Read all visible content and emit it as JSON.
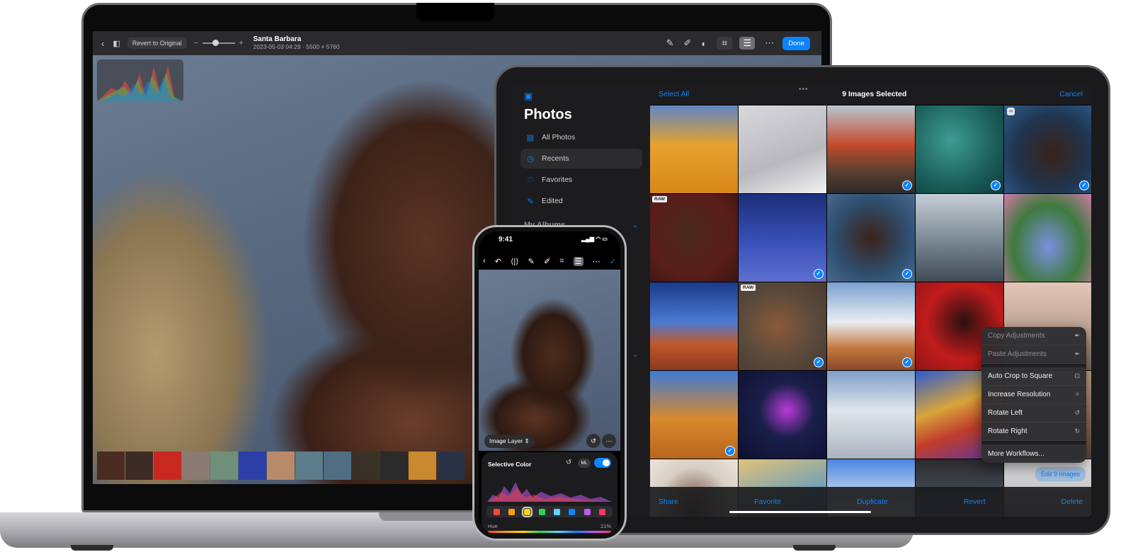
{
  "mac": {
    "toolbar": {
      "back_icon": "chevron-left-icon",
      "compare_icon": "compare-icon",
      "revert_label": "Revert to Original",
      "zoom_minus": "−",
      "zoom_plus": "+",
      "photo_title": "Santa Barbara",
      "photo_meta": "2023-05-03 04:29 · 5500 × 5760",
      "done_label": "Done",
      "tools": [
        "markup-icon",
        "retouch-icon",
        "filters-icon",
        "crop-icon",
        "adjust-icon",
        "more-icon"
      ]
    },
    "filmstrip_colors": [
      "#4a2c22",
      "#3d2b26",
      "#c8281f",
      "#8a7a72",
      "#6f8f7a",
      "#2c3fa8",
      "#b88a6a",
      "#5c7c8a",
      "#4f6e84",
      "#3a3228",
      "#2a2a2a",
      "#c9892f",
      "#2a3346"
    ]
  },
  "ipad": {
    "sidebar": {
      "toggle_icon": "sidebar-icon",
      "title": "Photos",
      "items": [
        {
          "label": "All Photos",
          "icon": "photos-icon"
        },
        {
          "label": "Recents",
          "icon": "clock-icon"
        },
        {
          "label": "Favorites",
          "icon": "heart-icon"
        },
        {
          "label": "Edited",
          "icon": "edit-icon"
        }
      ],
      "section": "My Albums"
    },
    "top": {
      "select_all": "Select All",
      "selected_title": "9 Images Selected",
      "cancel": "Cancel",
      "grabber": "•••"
    },
    "thumbs": [
      {
        "bg": "linear-gradient(180deg,#5f86c4 0%,#e6a12e 45%,#d88718 100%)",
        "check": false,
        "raw": false,
        "link": false
      },
      {
        "bg": "linear-gradient(160deg,#d8d8dc,#b8b8be 60%,#f2f2f2)",
        "check": false,
        "raw": false,
        "link": false
      },
      {
        "bg": "linear-gradient(180deg,#b9c6d0 0%,#c34a2c 45%,#5a4030 75%,#2e2a2a 100%)",
        "check": true,
        "raw": false,
        "link": false
      },
      {
        "bg": "radial-gradient(circle at 40% 40%,#3e9c92,#1b5e5a 60%,#0e3b3a)",
        "check": true,
        "raw": false,
        "link": false
      },
      {
        "bg": "radial-gradient(ellipse at 55% 55%,#3a2218,#1f3550 55%,#2f5e8e)",
        "check": true,
        "raw": false,
        "link": true
      },
      {
        "bg": "radial-gradient(ellipse at 45% 45%,#4a2a1d,#5a1e1a 60%,#3b1411)",
        "check": false,
        "raw": true,
        "link": false
      },
      {
        "bg": "linear-gradient(180deg,#1c2f7a 0%,#3a4fb8 55%,#5d6fd0 100%)",
        "check": true,
        "raw": false,
        "link": false
      },
      {
        "bg": "radial-gradient(ellipse at 50% 50%,#3a2218,#2f4f70 60%,#4a6a8e)",
        "check": true,
        "raw": false,
        "link": false
      },
      {
        "bg": "linear-gradient(180deg,#c6cdd6 0%,#7f8d98 50%,#3e4a54 100%)",
        "check": false,
        "raw": false,
        "link": false
      },
      {
        "bg": "radial-gradient(ellipse at 50% 60%,#7b8fe0,#3e7a3e 55%,#d07aa8)",
        "check": false,
        "raw": false,
        "link": false
      },
      {
        "bg": "linear-gradient(180deg,#1a3a8a 0%,#4a7ad0 45%,#c0582c 70%,#8c3a1e 100%)",
        "check": false,
        "raw": false,
        "link": false
      },
      {
        "bg": "radial-gradient(ellipse at 45% 50%,#8a5a38,#5a4a3c 55%,#4a3a30)",
        "check": true,
        "raw": true,
        "link": false
      },
      {
        "bg": "linear-gradient(180deg,#7aa0d0 0%,#e8edf2 45%,#c4783e 75%,#8a4a2a 100%)",
        "check": true,
        "raw": false,
        "link": false
      },
      {
        "bg": "radial-gradient(ellipse at 55% 45%,#2a1010,#c21c1c 55%,#8e1414)",
        "check": false,
        "raw": false,
        "link": false
      },
      {
        "bg": "linear-gradient(180deg,#e3c6b8 0%,#b9a090 60%,#7a6a5e 100%)",
        "check": false,
        "raw": false,
        "link": false
      },
      {
        "bg": "linear-gradient(180deg,#3d7ad6 0%,#d9892c 55%,#b8661e 100%)",
        "check": true,
        "raw": false,
        "link": false
      },
      {
        "bg": "radial-gradient(ellipse at 55% 45%,#b83ad8,#1a1f4a 40%,#0d1030)",
        "check": false,
        "raw": false,
        "link": false
      },
      {
        "bg": "linear-gradient(180deg,#7f9ec8 0%,#dfe5ec 45%,#c9d0d8 70%,#a8b3bf 100%)",
        "check": false,
        "raw": false,
        "link": false
      },
      {
        "bg": "linear-gradient(160deg,#2c5ad0 0%,#d8a43a 40%,#c03c2c 65%,#5a3aa0 100%)",
        "check": false,
        "raw": false,
        "link": false
      },
      {
        "bg": "linear-gradient(180deg,#c9a98c 0%,#8a6a58 60%,#5a4a40 100%)",
        "check": false,
        "raw": false,
        "link": false
      },
      {
        "bg": "radial-gradient(ellipse at 50% 60%,#5a3422,#d8cfc4 60%,#eae4dc)",
        "check": false,
        "raw": false,
        "link": false
      },
      {
        "bg": "linear-gradient(160deg,#e2c27a 0%,#6fa0b8 50%,#3a6e88 100%)",
        "check": false,
        "raw": false,
        "link": false
      },
      {
        "bg": "linear-gradient(180deg,#4a86e0 0%,#f4f6f8 60%,#d8e2ec 100%)",
        "check": false,
        "raw": false,
        "link": false
      },
      {
        "bg": "linear-gradient(180deg,#2a2a2c 0%,#6a7e9a 100%)",
        "check": false,
        "raw": false,
        "link": false
      },
      {
        "bg": "linear-gradient(180deg,#e6e6e8 0%,#8a8a8e 100%)",
        "check": false,
        "raw": false,
        "link": false
      }
    ],
    "context_menu": [
      {
        "label": "Copy Adjustments",
        "icon": "eyedropper-icon",
        "disabled": true
      },
      {
        "label": "Paste Adjustments",
        "icon": "eyedropper-icon",
        "disabled": true
      },
      {
        "label": "Auto Crop to Square",
        "icon": "crop-square-icon",
        "disabled": false
      },
      {
        "label": "Increase Resolution",
        "icon": "sparkle-icon",
        "disabled": false
      },
      {
        "label": "Rotate Left",
        "icon": "rotate-left-icon",
        "disabled": false
      },
      {
        "label": "Rotate Right",
        "icon": "rotate-right-icon",
        "disabled": false
      },
      {
        "label": "More Workflows...",
        "icon": "",
        "disabled": false
      }
    ],
    "edit_images": "Edit 9 Images",
    "bottom": [
      "Share",
      "Favorite",
      "Duplicate",
      "Revert",
      "Delete"
    ]
  },
  "iphone": {
    "time": "9:41",
    "status_icons": "▂▄▆ ◠ ▭",
    "image_layer": "Image Layer",
    "panel_title": "Selective Color",
    "ml_label": "ML",
    "hue_label": "Hue",
    "hue_value": "21%",
    "swatch_colors": [
      "#ff453a",
      "#ff9f0a",
      "#ffd60a",
      "#30d158",
      "#64d2ff",
      "#0a84ff",
      "#bf5af2",
      "#ff375f"
    ]
  }
}
